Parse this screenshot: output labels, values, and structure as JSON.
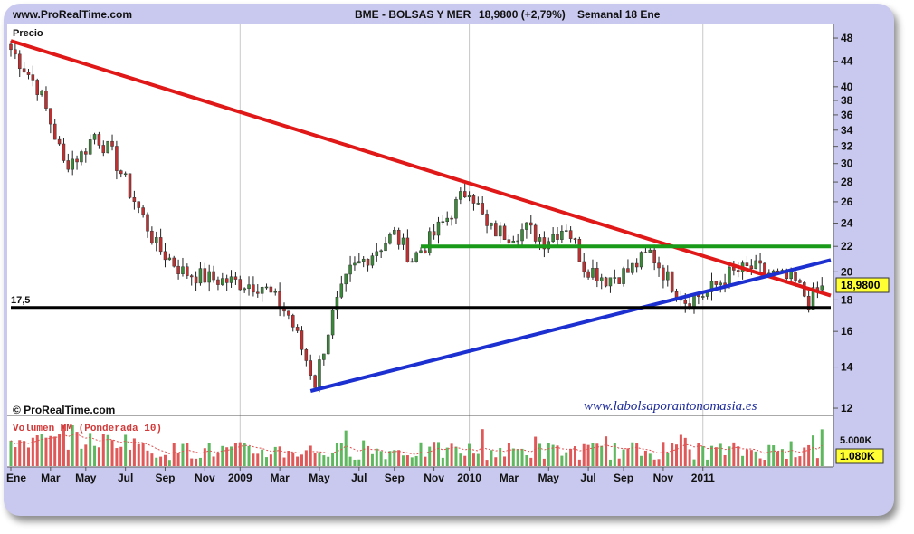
{
  "header": {
    "site": "www.ProRealTime.com",
    "instrument": "BME - BOLSAS Y MER",
    "quote": "18,9800 (+2,79%)",
    "timeframe": "Semanal  18 Ene"
  },
  "price_panel": {
    "label": "Precio",
    "copyright": "© ProRealTime.com",
    "watermark": "www.labolsaporantonomasia.es",
    "last_price_badge": "18,9800",
    "support_label": "17,5"
  },
  "volume_panel": {
    "label": "Volumen MM (Ponderada 10)",
    "axis_tick": "5.000K",
    "last_volume_badge": "1.080K"
  },
  "colors": {
    "frame": "#c9c9ef",
    "up_candle": "#3a8a3a",
    "down_candle": "#c03030",
    "resistance_line": "#e01818",
    "support_line": "#1c2fd0",
    "horizontal_green": "#199a19",
    "horizontal_black": "#000000"
  },
  "chart_data": {
    "type": "candlestick",
    "title": "BME - BOLSAS Y MER",
    "frequency": "weekly",
    "x_ticks": [
      "Ene",
      "Mar",
      "May",
      "Jul",
      "Sep",
      "Nov",
      "2009",
      "Mar",
      "May",
      "Jul",
      "Sep",
      "Nov",
      "2010",
      "Mar",
      "May",
      "Jul",
      "Sep",
      "Nov",
      "2011"
    ],
    "y_ticks": [
      12,
      14,
      16,
      18,
      20,
      22,
      24,
      26,
      28,
      30,
      32,
      34,
      36,
      38,
      40,
      44,
      48
    ],
    "y_scale": "log",
    "ylim": [
      11.8,
      50
    ],
    "last_close": 18.98,
    "change_pct": 2.79,
    "close_path": [
      {
        "x": 0,
        "close": 46
      },
      {
        "x": 6,
        "close": 40
      },
      {
        "x": 12,
        "close": 30
      },
      {
        "x": 16,
        "close": 31
      },
      {
        "x": 19,
        "close": 33.5
      },
      {
        "x": 23,
        "close": 31
      },
      {
        "x": 27,
        "close": 27
      },
      {
        "x": 33,
        "close": 22
      },
      {
        "x": 39,
        "close": 20
      },
      {
        "x": 45,
        "close": 19.5
      },
      {
        "x": 52,
        "close": 19.2
      },
      {
        "x": 57,
        "close": 19
      },
      {
        "x": 60,
        "close": 18
      },
      {
        "x": 63,
        "close": 17
      },
      {
        "x": 66,
        "close": 15
      },
      {
        "x": 69,
        "close": 13.2
      },
      {
        "x": 73,
        "close": 17
      },
      {
        "x": 77,
        "close": 20
      },
      {
        "x": 82,
        "close": 21.5
      },
      {
        "x": 87,
        "close": 23
      },
      {
        "x": 91,
        "close": 21
      },
      {
        "x": 95,
        "close": 22.5
      },
      {
        "x": 99,
        "close": 24.5
      },
      {
        "x": 104,
        "close": 27.5
      },
      {
        "x": 108,
        "close": 23.5
      },
      {
        "x": 113,
        "close": 23
      },
      {
        "x": 117,
        "close": 23.5
      },
      {
        "x": 121,
        "close": 22.5
      },
      {
        "x": 126,
        "close": 23.8
      },
      {
        "x": 130,
        "close": 20.5
      },
      {
        "x": 135,
        "close": 19.5
      },
      {
        "x": 140,
        "close": 20
      },
      {
        "x": 145,
        "close": 21.5
      },
      {
        "x": 149,
        "close": 19.5
      },
      {
        "x": 153,
        "close": 18
      },
      {
        "x": 158,
        "close": 18.5
      },
      {
        "x": 163,
        "close": 19.8
      },
      {
        "x": 168,
        "close": 20.3
      },
      {
        "x": 173,
        "close": 19.8
      },
      {
        "x": 178,
        "close": 19.2
      },
      {
        "x": 181,
        "close": 17.9
      },
      {
        "x": 184,
        "close": 18.98
      }
    ],
    "volume": {
      "ma_label": "Volumen MM (Ponderada 10)",
      "tick": "5.000K",
      "last": "1.080K"
    },
    "trendlines": [
      {
        "name": "Resistencia bajista",
        "color": "#e01818",
        "from": {
          "x": 0,
          "y": 47.5
        },
        "to": {
          "x": 186,
          "y": 18.3
        }
      },
      {
        "name": "Soporte alcista",
        "color": "#1c2fd0",
        "from": {
          "x": 68,
          "y": 12.8
        },
        "to": {
          "x": 186,
          "y": 20.9
        }
      },
      {
        "name": "Horizontal 22",
        "color": "#199a19",
        "from": {
          "x": 93,
          "y": 22
        },
        "to": {
          "x": 186,
          "y": 22
        }
      },
      {
        "name": "Soporte 17,5",
        "color": "#000000",
        "from": {
          "x": 0,
          "y": 17.5
        },
        "to": {
          "x": 186,
          "y": 17.5
        }
      }
    ]
  }
}
